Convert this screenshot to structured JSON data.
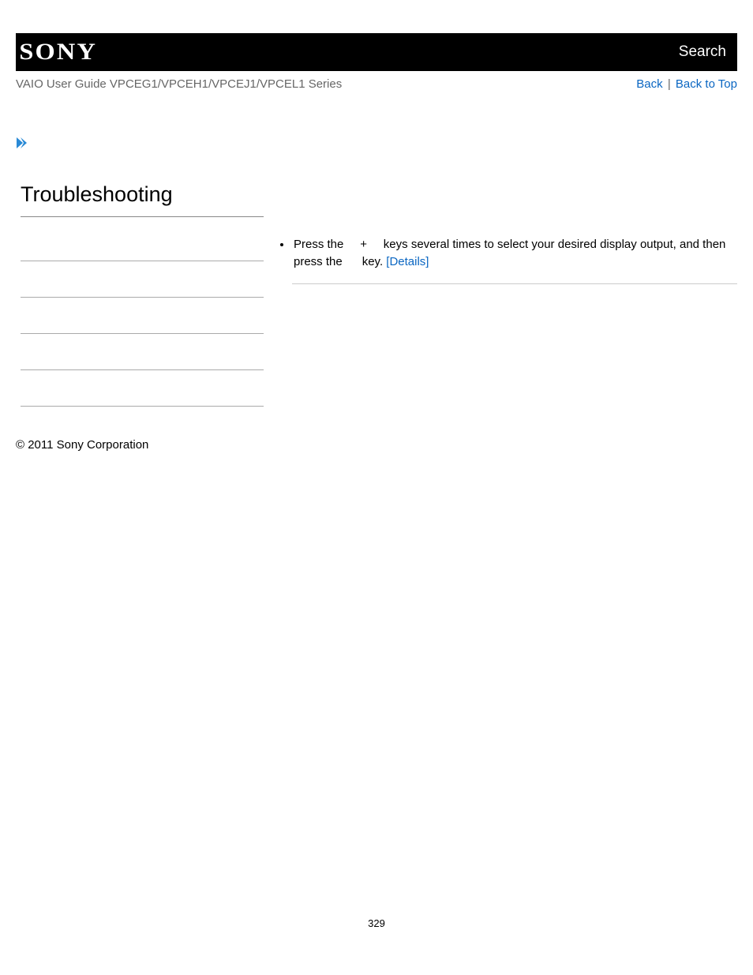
{
  "header": {
    "logo_text": "SONY",
    "search_label": "Search"
  },
  "subheader": {
    "guide_title": "VAIO User Guide VPCEG1/VPCEH1/VPCEJ1/VPCEL1 Series",
    "back_label": "Back",
    "separator": "|",
    "back_to_top_label": "Back to Top"
  },
  "page": {
    "heading": "Troubleshooting"
  },
  "content": {
    "bullet": {
      "t1": "Press the ",
      "plus": "+",
      "t2": " keys several times to select your desired display output, and then press the ",
      "t3": " key. ",
      "details_label": "[Details]"
    }
  },
  "footer": {
    "copyright": "© 2011 Sony Corporation"
  },
  "pagenum": "329"
}
